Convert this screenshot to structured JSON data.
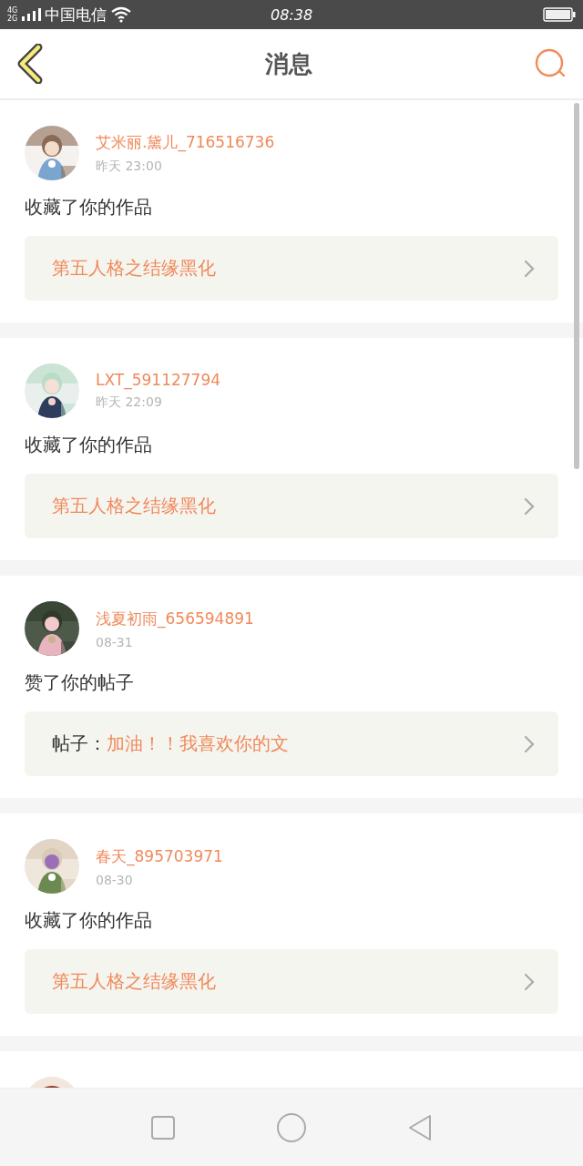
{
  "status_bar": {
    "network_top": "4G",
    "network_bottom": "2G",
    "carrier": "中国电信",
    "time": "08:38"
  },
  "header": {
    "title": "消息"
  },
  "notifications": [
    {
      "user": "艾米丽.黛儿_716516736",
      "time": "昨天 23:00",
      "action": "收藏了你的作品",
      "link": {
        "kind": "work",
        "title": "第五人格之结缘黑化"
      }
    },
    {
      "user": "LXT_591127794",
      "time": "昨天 22:09",
      "action": "收藏了你的作品",
      "link": {
        "kind": "work",
        "title": "第五人格之结缘黑化"
      }
    },
    {
      "user": "浅夏初雨_656594891",
      "time": "08-31",
      "action": "赞了你的帖子",
      "link": {
        "kind": "post",
        "prefix": "帖子：",
        "title": "加油！！我喜欢你的文"
      }
    },
    {
      "user": "春天_895703971",
      "time": "08-30",
      "action": "收藏了你的作品",
      "link": {
        "kind": "work",
        "title": "第五人格之结缘黑化"
      }
    }
  ]
}
